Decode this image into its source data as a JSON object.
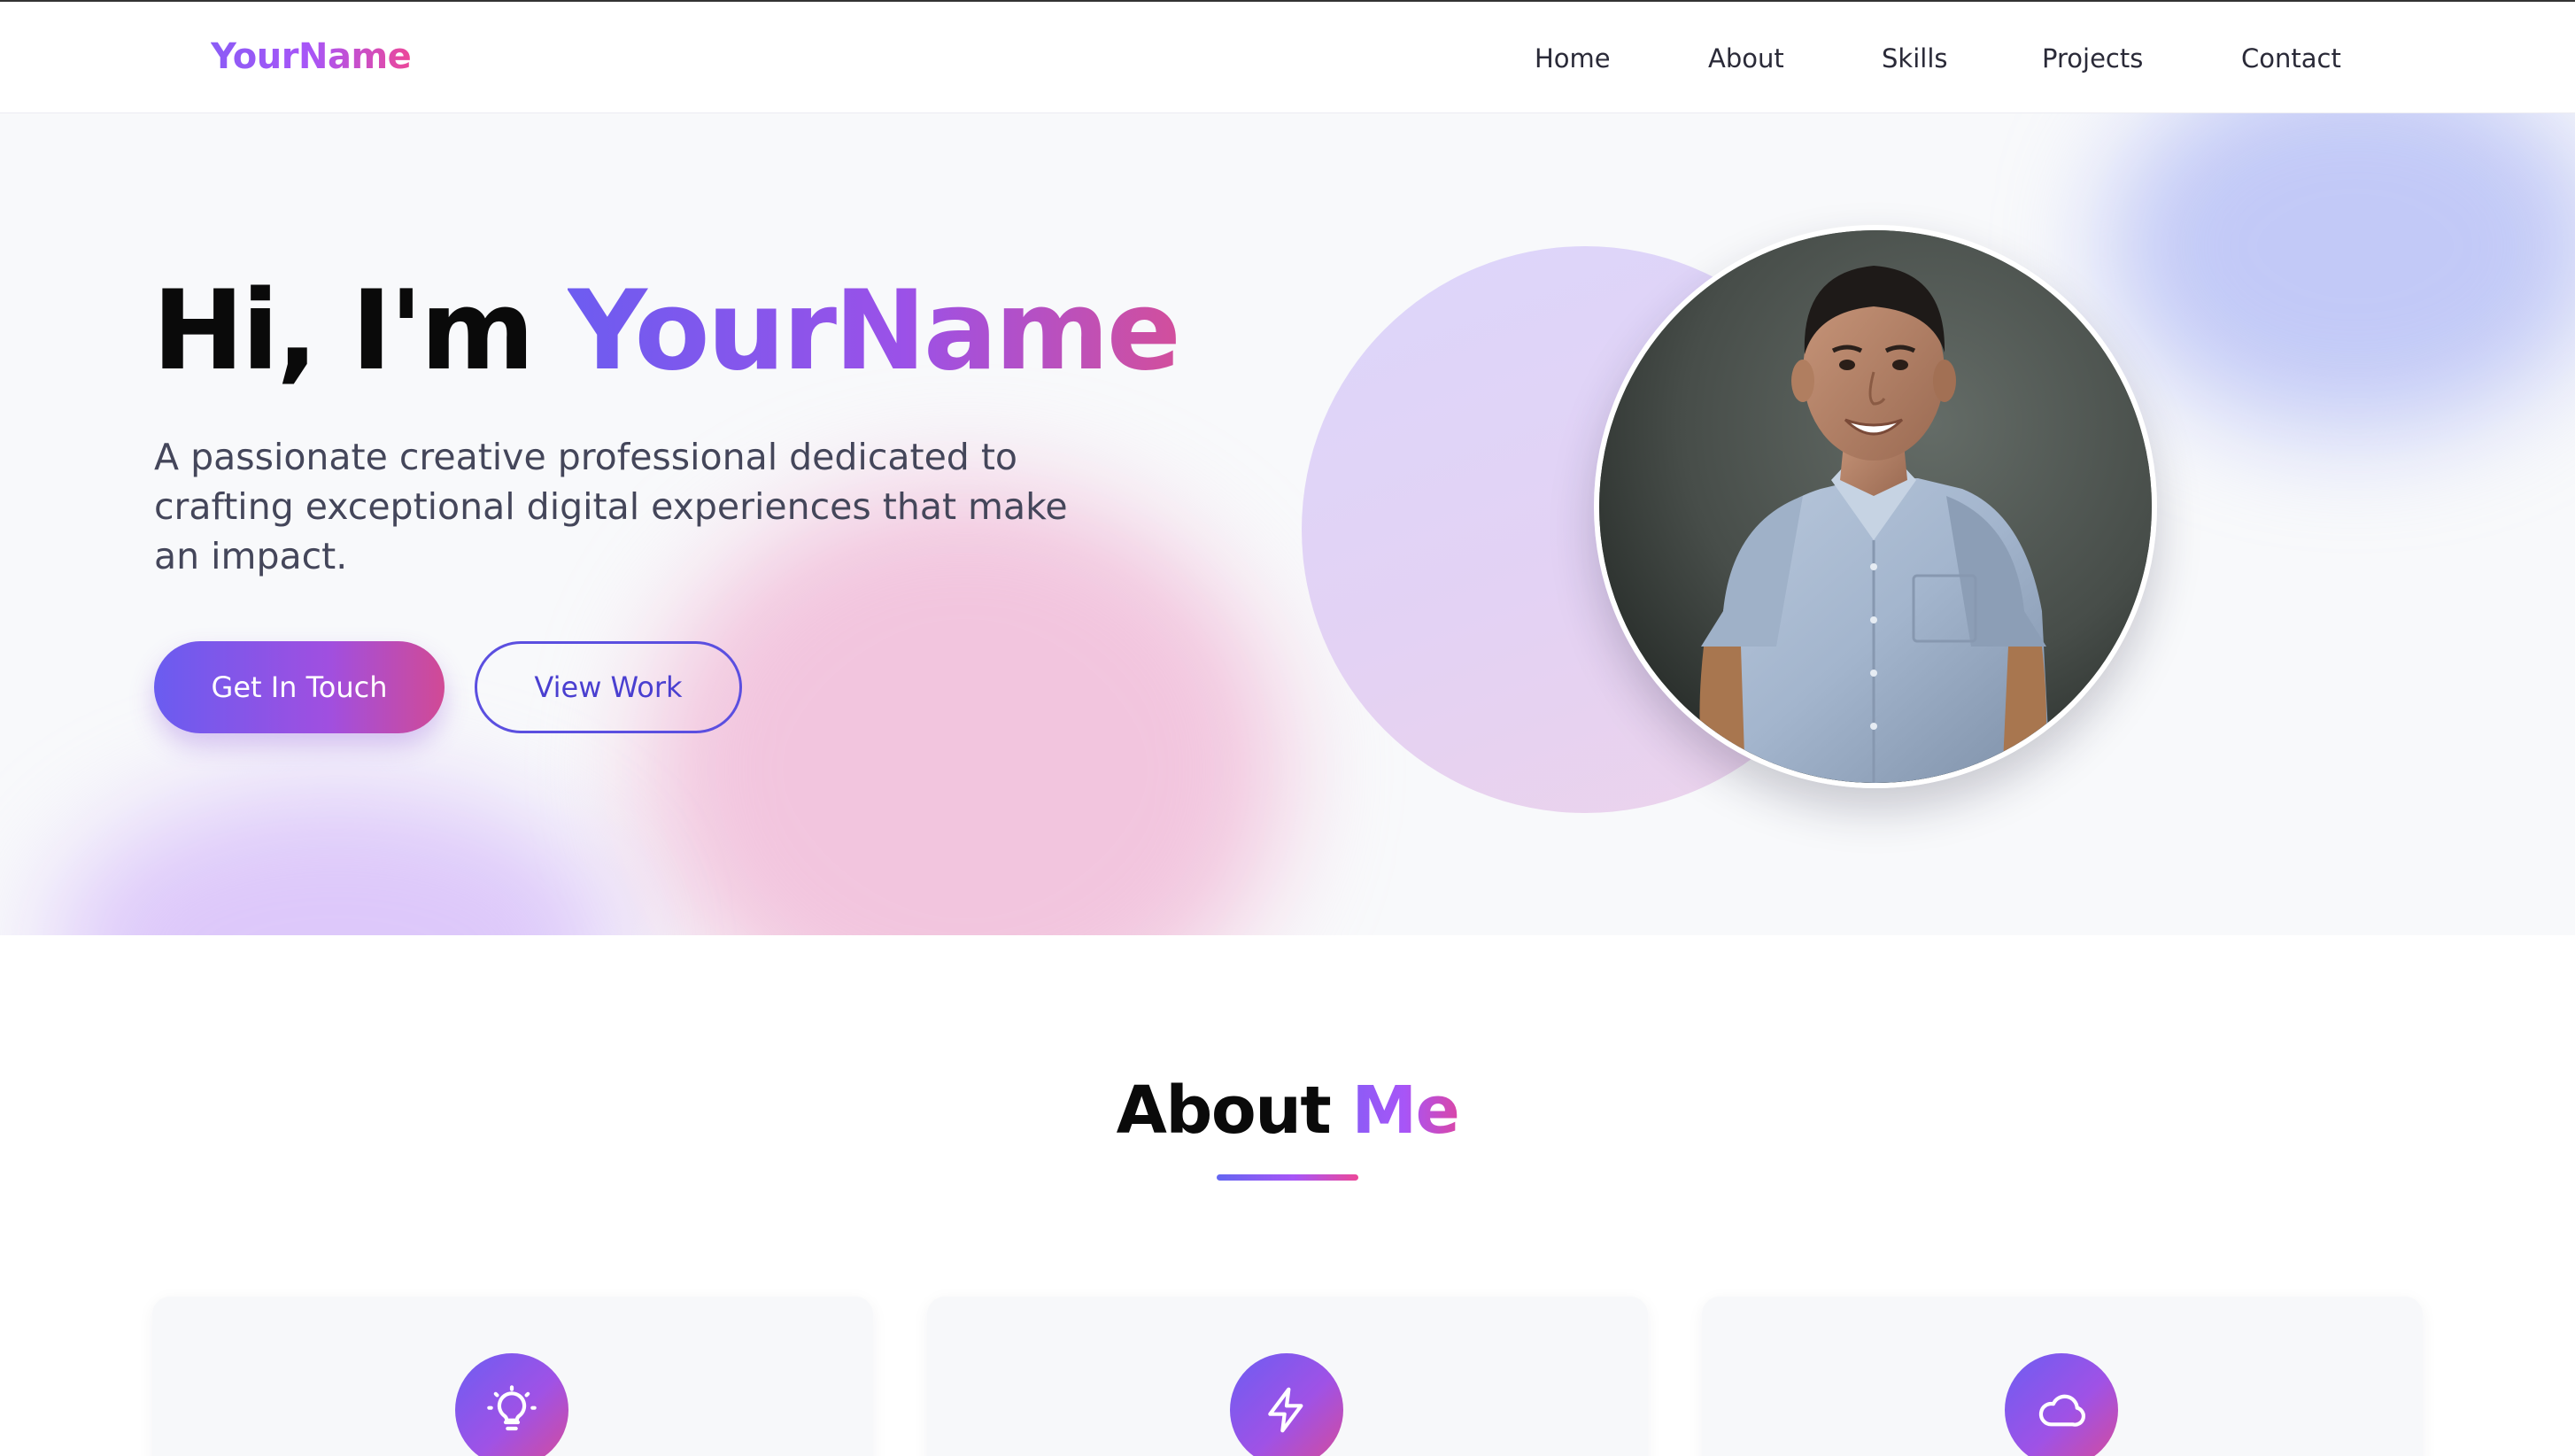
{
  "navbar": {
    "logo": "YourName",
    "links": [
      {
        "label": "Home"
      },
      {
        "label": "About"
      },
      {
        "label": "Skills"
      },
      {
        "label": "Projects"
      },
      {
        "label": "Contact"
      }
    ]
  },
  "hero": {
    "greeting": "Hi, I'm",
    "name": "YourName",
    "subtitle": "A passionate creative professional dedicated to crafting exceptional digital experiences that make an impact.",
    "primary_button": "Get In Touch",
    "secondary_button": "View Work"
  },
  "about": {
    "title_plain": "About",
    "title_accent": "Me",
    "cards": [
      {
        "icon": "lightbulb-icon"
      },
      {
        "icon": "lightning-icon"
      },
      {
        "icon": "cloud-icon"
      }
    ]
  },
  "colors": {
    "accent_start": "#6366f1",
    "accent_mid": "#a855f7",
    "accent_end": "#ec4899",
    "hero_background": "#f8f9fb"
  }
}
